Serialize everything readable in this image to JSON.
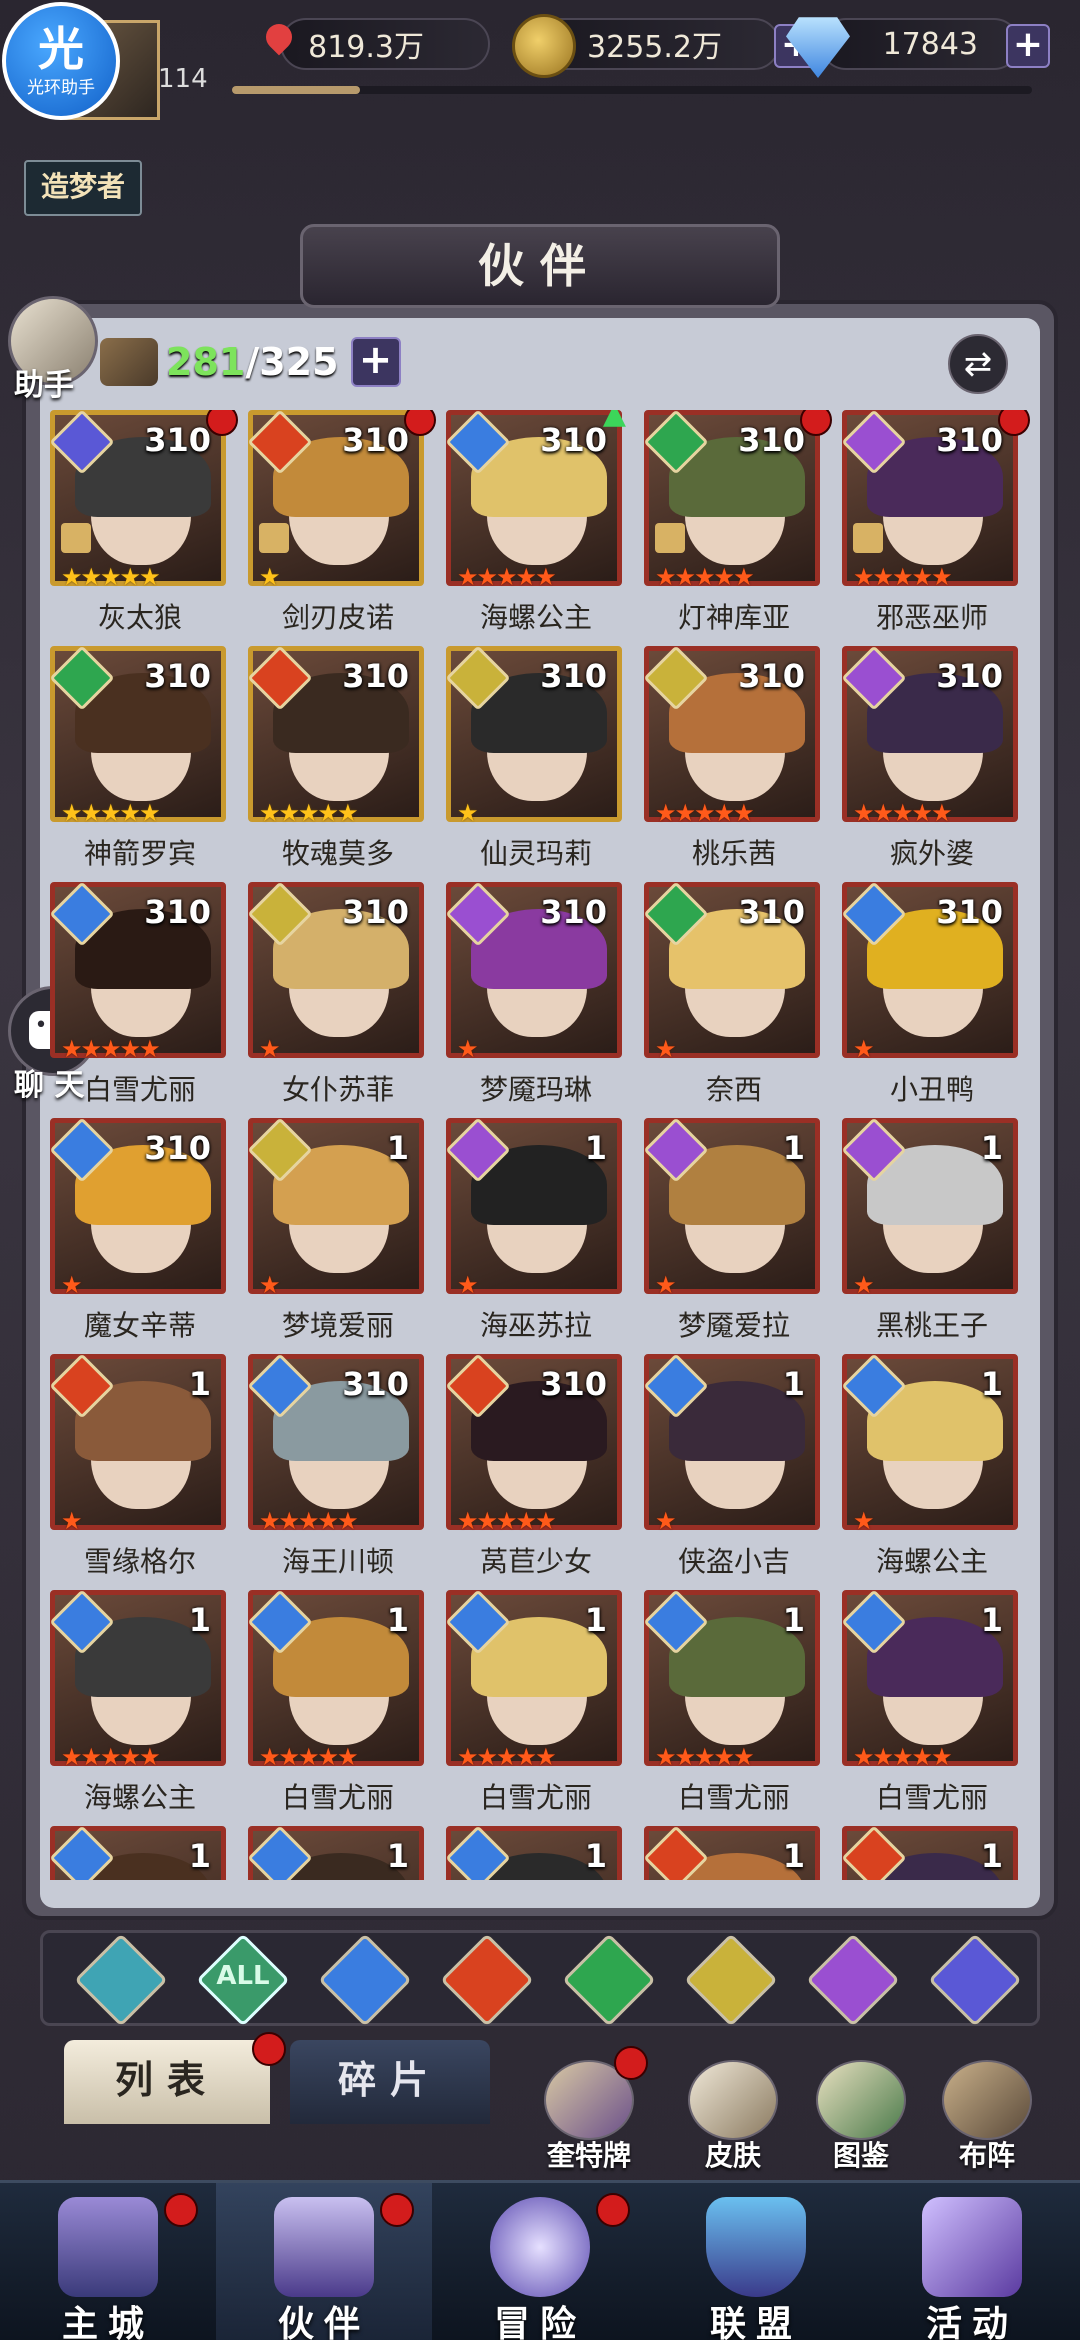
{
  "helper_badge": {
    "big": "光",
    "small": "光环助手"
  },
  "player": {
    "level": "114",
    "rank": "造梦者"
  },
  "resources": {
    "stamina": "819.3万",
    "gold": "3255.2万",
    "gems": "17843"
  },
  "panel": {
    "title": "伙伴",
    "count_current": "281",
    "count_total": "/325",
    "plus": "+",
    "swap": "⇄"
  },
  "side": {
    "helper": "助手",
    "chat": "聊 天"
  },
  "colors": {
    "fire": "#d9421f",
    "water": "#3a7de0",
    "wind": "#2ea64f",
    "light": "#c9b23a",
    "dark": "#9a4fd1",
    "space": "#5a58d6",
    "neutral": "#3fa4b4"
  },
  "partners": [
    {
      "name": "灰太狼",
      "level": "310",
      "element": "space",
      "stars": "5g",
      "frame": "gold",
      "dot": true,
      "lock": true
    },
    {
      "name": "剑刃皮诺",
      "level": "310",
      "element": "fire",
      "stars": "1g",
      "frame": "gold",
      "dot": true,
      "lock": true
    },
    {
      "name": "海螺公主",
      "level": "310",
      "element": "water",
      "stars": "5r",
      "frame": "red",
      "up": true
    },
    {
      "name": "灯神库亚",
      "level": "310",
      "element": "wind",
      "stars": "5r",
      "frame": "red",
      "dot": true,
      "lock": true
    },
    {
      "name": "邪恶巫师",
      "level": "310",
      "element": "dark",
      "stars": "5r",
      "frame": "red",
      "dot": true,
      "lock": true
    },
    {
      "name": "神箭罗宾",
      "level": "310",
      "element": "wind",
      "stars": "5g",
      "frame": "gold"
    },
    {
      "name": "牧魂莫多",
      "level": "310",
      "element": "fire",
      "stars": "5g",
      "frame": "gold"
    },
    {
      "name": "仙灵玛莉",
      "level": "310",
      "element": "light",
      "stars": "1g",
      "frame": "gold"
    },
    {
      "name": "桃乐茜",
      "level": "310",
      "element": "light",
      "stars": "5r",
      "frame": "red"
    },
    {
      "name": "疯外婆",
      "level": "310",
      "element": "dark",
      "stars": "5r",
      "frame": "red"
    },
    {
      "name": "白雪尤丽",
      "level": "310",
      "element": "water",
      "stars": "5r",
      "frame": "red"
    },
    {
      "name": "女仆苏菲",
      "level": "310",
      "element": "light",
      "stars": "1r",
      "frame": "red"
    },
    {
      "name": "梦魇玛琳",
      "level": "310",
      "element": "dark",
      "stars": "1r",
      "frame": "red"
    },
    {
      "name": "奈西",
      "level": "310",
      "element": "wind",
      "stars": "1r",
      "frame": "red"
    },
    {
      "name": "小丑鸭",
      "level": "310",
      "element": "water",
      "stars": "1r",
      "frame": "red"
    },
    {
      "name": "魔女辛蒂",
      "level": "310",
      "element": "water",
      "stars": "1r",
      "frame": "red"
    },
    {
      "name": "梦境爱丽",
      "level": "1",
      "element": "light",
      "stars": "1r",
      "frame": "red"
    },
    {
      "name": "海巫苏拉",
      "level": "1",
      "element": "dark",
      "stars": "1r",
      "frame": "red"
    },
    {
      "name": "梦魇爱拉",
      "level": "1",
      "element": "dark",
      "stars": "1r",
      "frame": "red"
    },
    {
      "name": "黑桃王子",
      "level": "1",
      "element": "dark",
      "stars": "1r",
      "frame": "red"
    },
    {
      "name": "雪缘格尔",
      "level": "1",
      "element": "fire",
      "stars": "1r",
      "frame": "red"
    },
    {
      "name": "海王川顿",
      "level": "310",
      "element": "water",
      "stars": "5r",
      "frame": "red"
    },
    {
      "name": "莴苣少女",
      "level": "310",
      "element": "fire",
      "stars": "5r",
      "frame": "red"
    },
    {
      "name": "侠盗小吉",
      "level": "1",
      "element": "water",
      "stars": "1r",
      "frame": "red"
    },
    {
      "name": "海螺公主",
      "level": "1",
      "element": "water",
      "stars": "1r",
      "frame": "red"
    },
    {
      "name": "海螺公主",
      "level": "1",
      "element": "water",
      "stars": "5r",
      "frame": "red"
    },
    {
      "name": "白雪尤丽",
      "level": "1",
      "element": "water",
      "stars": "5r",
      "frame": "red"
    },
    {
      "name": "白雪尤丽",
      "level": "1",
      "element": "water",
      "stars": "5r",
      "frame": "red"
    },
    {
      "name": "白雪尤丽",
      "level": "1",
      "element": "water",
      "stars": "5r",
      "frame": "red"
    },
    {
      "name": "白雪尤丽",
      "level": "1",
      "element": "water",
      "stars": "5r",
      "frame": "red"
    },
    {
      "name": "",
      "level": "1",
      "element": "water",
      "stars": "",
      "frame": "red"
    },
    {
      "name": "",
      "level": "1",
      "element": "water",
      "stars": "",
      "frame": "red"
    },
    {
      "name": "",
      "level": "1",
      "element": "water",
      "stars": "",
      "frame": "red"
    },
    {
      "name": "",
      "level": "1",
      "element": "fire",
      "stars": "",
      "frame": "red"
    },
    {
      "name": "",
      "level": "1",
      "element": "fire",
      "stars": "",
      "frame": "red"
    }
  ],
  "filters": [
    {
      "id": "neutral",
      "label": ""
    },
    {
      "id": "all",
      "label": "ALL"
    },
    {
      "id": "water",
      "label": ""
    },
    {
      "id": "fire",
      "label": ""
    },
    {
      "id": "wind",
      "label": ""
    },
    {
      "id": "light",
      "label": ""
    },
    {
      "id": "dark",
      "label": ""
    },
    {
      "id": "space",
      "label": ""
    }
  ],
  "tabs": {
    "list": "列表",
    "fragments": "碎片"
  },
  "tools": [
    "奎特牌",
    "皮肤",
    "图鉴",
    "布阵"
  ],
  "nav": [
    "主城",
    "伙伴",
    "冒险",
    "联盟",
    "活动"
  ]
}
